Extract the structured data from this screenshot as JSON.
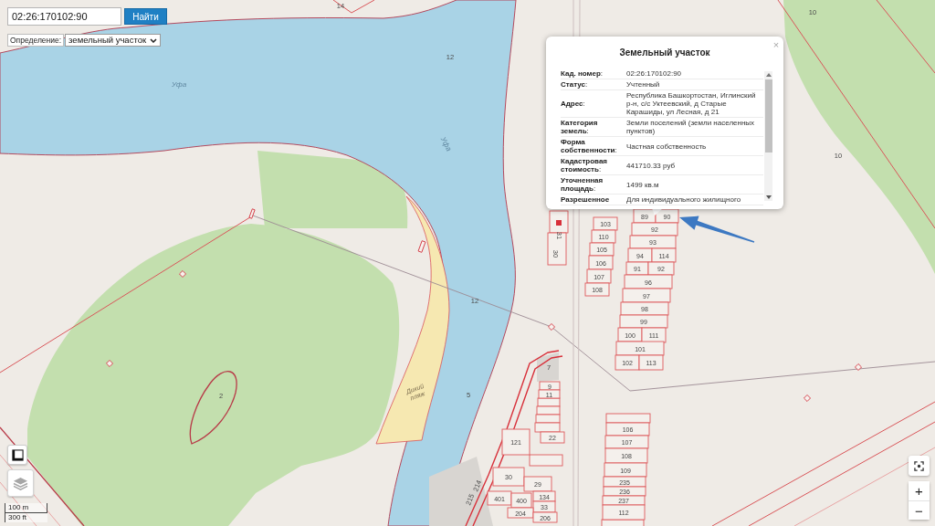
{
  "search": {
    "value": "02:26:170102:90",
    "button": "Найти"
  },
  "definition": {
    "label": "Определение:",
    "value": "земельный участок"
  },
  "map": {
    "labels": [
      {
        "text": "14",
        "kind": "parcel"
      },
      {
        "text": "12",
        "kind": "parcel"
      },
      {
        "text": "Уфа",
        "kind": "water"
      },
      {
        "text": "Уфа",
        "kind": "water"
      },
      {
        "text": "10",
        "kind": "parcel"
      },
      {
        "text": "10",
        "kind": "parcel"
      },
      {
        "text": "12",
        "kind": "parcel"
      },
      {
        "text": "2",
        "kind": "parcel"
      },
      {
        "text": "Дикий пляж",
        "kind": "place"
      },
      {
        "text": "5",
        "kind": "parcel"
      },
      {
        "text": "7",
        "kind": "parcel"
      },
      {
        "text": "31",
        "kind": "parcel"
      },
      {
        "text": "30",
        "kind": "parcel"
      },
      {
        "text": "214",
        "kind": "parcel"
      },
      {
        "text": "215",
        "kind": "parcel"
      }
    ],
    "parcels": [
      {
        "number": "103"
      },
      {
        "number": "110"
      },
      {
        "number": "105"
      },
      {
        "number": "106"
      },
      {
        "number": "107"
      },
      {
        "number": "108"
      },
      {
        "number": "89"
      },
      {
        "number": "90"
      },
      {
        "number": "92"
      },
      {
        "number": "93"
      },
      {
        "number": "94"
      },
      {
        "number": "114"
      },
      {
        "number": "91"
      },
      {
        "number": "92"
      },
      {
        "number": "96"
      },
      {
        "number": "97"
      },
      {
        "number": "98"
      },
      {
        "number": "99"
      },
      {
        "number": "100"
      },
      {
        "number": "111"
      },
      {
        "number": "101"
      },
      {
        "number": "102"
      },
      {
        "number": "113"
      },
      {
        "number": "9"
      },
      {
        "number": "11"
      },
      {
        "number": "22"
      },
      {
        "number": "121"
      },
      {
        "number": "30"
      },
      {
        "number": "29"
      },
      {
        "number": "401"
      },
      {
        "number": "400"
      },
      {
        "number": "134"
      },
      {
        "number": "33"
      },
      {
        "number": "204"
      },
      {
        "number": "206"
      },
      {
        "number": "106"
      },
      {
        "number": "107"
      },
      {
        "number": "108"
      },
      {
        "number": "109"
      },
      {
        "number": "235"
      },
      {
        "number": "236"
      },
      {
        "number": "237"
      },
      {
        "number": "112"
      }
    ]
  },
  "popup": {
    "title": "Земельный участок",
    "close": "×",
    "fields": [
      {
        "label": "**Кад. номер**:",
        "value": "02:26:170102:90"
      },
      {
        "label": "**Статус**:",
        "value": "Учтенный"
      },
      {
        "label": "**Адрес**:",
        "value": "Республика Башкортостан, Иглинский р-н, с/с Уктеевский, д Старые Карашиды, ул Лесная, д 21"
      },
      {
        "label": "**Категория земель**:",
        "value": "Земли поселений (земли населенных пунктов)"
      },
      {
        "label": "**Форма собственности**:",
        "value": "Частная собственность"
      },
      {
        "label": "**Кадастровая стоимость**:",
        "value": "441710.33 руб"
      },
      {
        "label": "**Уточненная площадь**:",
        "value": "1499 кв.м"
      },
      {
        "label": "**Разрешенное**",
        "value": "Для индивидуального жилищного"
      }
    ]
  },
  "map_controls": {
    "scale": [
      "100 m",
      "300 ft"
    ],
    "zoom_in": "+",
    "zoom_out": "−"
  }
}
